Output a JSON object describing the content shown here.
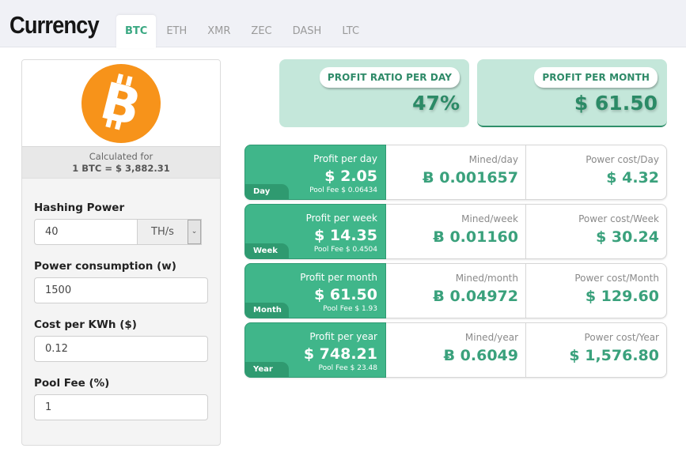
{
  "header": {
    "title": "Currency",
    "tabs": [
      {
        "label": "BTC",
        "active": true
      },
      {
        "label": "ETH",
        "active": false
      },
      {
        "label": "XMR",
        "active": false
      },
      {
        "label": "ZEC",
        "active": false
      },
      {
        "label": "DASH",
        "active": false
      },
      {
        "label": "LTC",
        "active": false
      }
    ]
  },
  "coin": {
    "icon": "bitcoin-logo-icon",
    "color": "#f7931a",
    "calculated_label": "Calculated for",
    "rate": "1 BTC = $ 3,882.31"
  },
  "form": {
    "hashing_power": {
      "label": "Hashing Power",
      "value": "40",
      "unit": "TH/s"
    },
    "power_consumption": {
      "label": "Power consumption (w)",
      "value": "1500"
    },
    "cost_per_kwh": {
      "label": "Cost per KWh ($)",
      "value": "0.12"
    },
    "pool_fee": {
      "label": "Pool Fee (%)",
      "value": "1"
    }
  },
  "summary": {
    "profit_ratio": {
      "label": "PROFIT RATIO PER DAY",
      "value": "47%"
    },
    "profit_month": {
      "label": "PROFIT PER MONTH",
      "value": "$ 61.50"
    }
  },
  "rows": [
    {
      "tag": "Day",
      "profit_label": "Profit per day",
      "profit": "$ 2.05",
      "pool_fee": "Pool Fee $ 0.06434",
      "mined_label": "Mined/day",
      "mined": "Ƀ 0.001657",
      "power_label": "Power cost/Day",
      "power": "$ 4.32"
    },
    {
      "tag": "Week",
      "profit_label": "Profit per week",
      "profit": "$ 14.35",
      "pool_fee": "Pool Fee $ 0.4504",
      "mined_label": "Mined/week",
      "mined": "Ƀ 0.01160",
      "power_label": "Power cost/Week",
      "power": "$ 30.24"
    },
    {
      "tag": "Month",
      "profit_label": "Profit per month",
      "profit": "$ 61.50",
      "pool_fee": "Pool Fee $ 1.93",
      "mined_label": "Mined/month",
      "mined": "Ƀ 0.04972",
      "power_label": "Power cost/Month",
      "power": "$ 129.60"
    },
    {
      "tag": "Year",
      "profit_label": "Profit per year",
      "profit": "$ 748.21",
      "pool_fee": "Pool Fee $ 23.48",
      "mined_label": "Mined/year",
      "mined": "Ƀ 0.6049",
      "power_label": "Power cost/Year",
      "power": "$ 1,576.80"
    }
  ],
  "colors": {
    "accent": "#3aa882",
    "profit_green": "#40b68a",
    "summary_bg": "#c4e7da",
    "bitcoin_orange": "#f7931a"
  }
}
